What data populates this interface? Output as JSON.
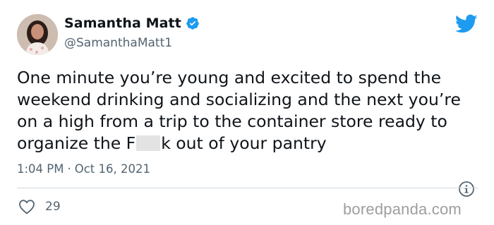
{
  "author": {
    "display_name": "Samantha Matt",
    "handle": "@SamanthaMatt1",
    "verified": true
  },
  "tweet": {
    "text_before_censor": "One minute you’re young and excited to spend the weekend drinking and socializing and the next you’re on a high from a trip to the container store ready to organize the F",
    "text_after_censor": "k out of your pantry",
    "time": "1:04 PM",
    "separator": "·",
    "date": "Oct 16, 2021"
  },
  "engagement": {
    "likes": "29"
  },
  "watermark": "boredpanda.com",
  "icons": {
    "logo": "twitter-bird-icon",
    "verified": "verified-badge-icon",
    "info": "info-icon",
    "like": "heart-icon"
  },
  "colors": {
    "twitter_blue": "#1d9bf0",
    "text_primary": "#0f1419",
    "text_secondary": "#536471",
    "divider": "#cfd9de",
    "watermark": "#9e9e9e"
  }
}
